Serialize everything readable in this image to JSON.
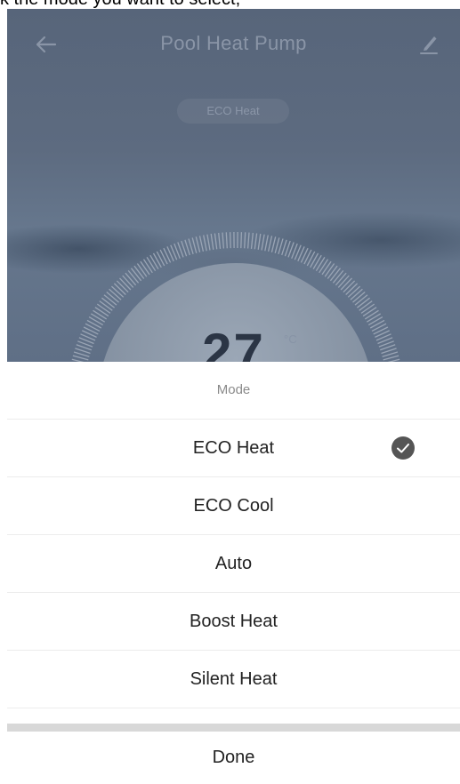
{
  "caption": {
    "text": "k the mode you want to select,"
  },
  "header": {
    "title": "Pool Heat Pump",
    "back_icon": "arrow-left-icon",
    "edit_icon": "pencil-icon"
  },
  "current_mode": {
    "label": "ECO Heat"
  },
  "temperature": {
    "value": "27",
    "unit": "°C"
  },
  "mode_sheet": {
    "title": "Mode",
    "options": [
      {
        "label": "ECO Heat",
        "selected": true
      },
      {
        "label": "ECO Cool",
        "selected": false
      },
      {
        "label": "Auto",
        "selected": false
      },
      {
        "label": "Boost Heat",
        "selected": false
      },
      {
        "label": "Silent Heat",
        "selected": false
      }
    ],
    "selected_icon": "checkmark-circle-icon",
    "done_label": "Done"
  },
  "colors": {
    "overlay": "#5d6b80",
    "sheet_background": "#ffffff",
    "check_badge": "#555555",
    "divider": "#d8d8d8"
  }
}
